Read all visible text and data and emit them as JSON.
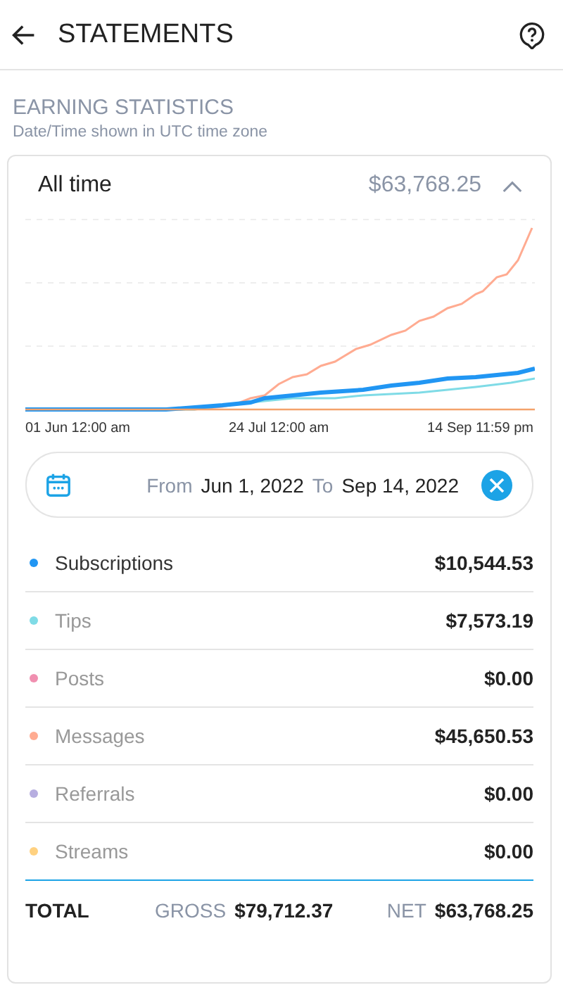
{
  "header": {
    "title": "STATEMENTS"
  },
  "section": {
    "title": "EARNING STATISTICS",
    "subtitle": "Date/Time shown in UTC time zone"
  },
  "card": {
    "period": "All time",
    "amount": "$63,768.25",
    "expanded": true,
    "x_labels": [
      "01 Jun 12:00 am",
      "24 Jul 12:00 am",
      "14 Sep 11:59 pm"
    ],
    "date_range": {
      "from_label": "From",
      "from": "Jun 1, 2022",
      "to_label": "To",
      "to": "Sep 14, 2022"
    },
    "categories": [
      {
        "name": "Subscriptions",
        "amount": "$10,544.53",
        "color": "#2196f3",
        "selected": true
      },
      {
        "name": "Tips",
        "amount": "$7,573.19",
        "color": "#7fdbe6",
        "selected": false
      },
      {
        "name": "Posts",
        "amount": "$0.00",
        "color": "#f08fb0",
        "selected": false
      },
      {
        "name": "Messages",
        "amount": "$45,650.53",
        "color": "#ffab91",
        "selected": false
      },
      {
        "name": "Referrals",
        "amount": "$0.00",
        "color": "#b7aee0",
        "selected": false
      },
      {
        "name": "Streams",
        "amount": "$0.00",
        "color": "#ffd180",
        "selected": false
      }
    ],
    "total": {
      "label": "TOTAL",
      "gross_label": "GROSS",
      "gross": "$79,712.37",
      "net_label": "NET",
      "net": "$63,768.25"
    }
  }
}
